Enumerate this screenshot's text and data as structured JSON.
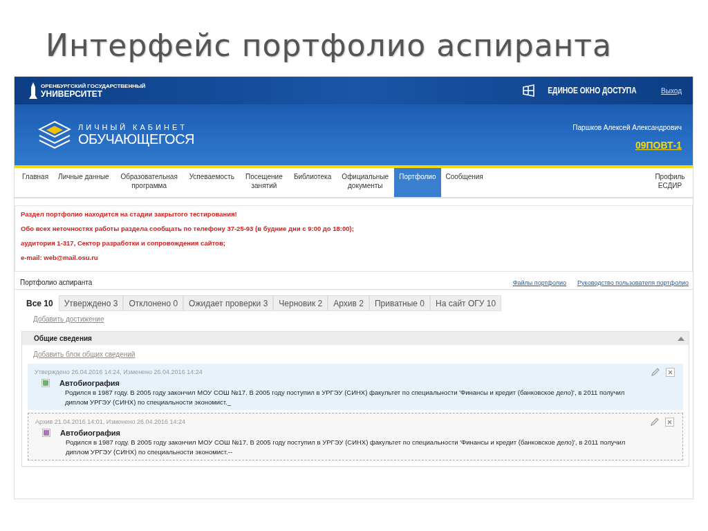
{
  "slide_title": "Интерфейс портфолио аспиранта",
  "header": {
    "university_small": "ОРЕНБУРГСКИЙ ГОСУДАРСТВЕННЫЙ",
    "university": "УНИВЕРСИТЕТ",
    "single_window": "ЕДИНОЕ ОКНО ДОСТУПА",
    "logout": "Выход",
    "cabinet_small": "ЛИЧНЫЙ КАБИНЕТ",
    "cabinet": "ОБУЧАЮЩЕГОСЯ",
    "user_name": "Паршков Алексей Александрович",
    "group": "09ПОВТ-1"
  },
  "nav": [
    {
      "label": "Главная",
      "selected": false
    },
    {
      "label": "Личные данные",
      "selected": false
    },
    {
      "label": "Образовательная программа",
      "selected": false
    },
    {
      "label": "Успеваемость",
      "selected": false
    },
    {
      "label": "Посещение занятий",
      "selected": false
    },
    {
      "label": "Библиотека",
      "selected": false
    },
    {
      "label": "Официальные документы",
      "selected": false
    },
    {
      "label": "Портфолио",
      "selected": true
    },
    {
      "label": "Сообщения",
      "selected": false
    }
  ],
  "nav_right": "Профиль ЕСДИР",
  "notice": [
    "Раздел портфолио находится на стадии закрытого тестирования!",
    "Обо всех неточностях работы раздела сообщать по телефону 37-25-93 (в будние дни с 9:00 до 18:00);",
    "аудитория 1-317, Сектор разработки и сопровождения сайтов;",
    "e-mail: web@mail.osu.ru"
  ],
  "portfolio_title": "Портфолио аспиранта",
  "links": [
    "Файлы портфолио",
    "Руководство пользователя портфолио"
  ],
  "tabs": [
    {
      "label": "Все 10",
      "selected": true
    },
    {
      "label": "Утверждено 3",
      "selected": false
    },
    {
      "label": "Отклонено 0",
      "selected": false
    },
    {
      "label": "Ожидает проверки 3",
      "selected": false
    },
    {
      "label": "Черновик 2",
      "selected": false
    },
    {
      "label": "Архив 2",
      "selected": false
    },
    {
      "label": "Приватные 0",
      "selected": false
    },
    {
      "label": "На сайт ОГУ 10",
      "selected": false
    }
  ],
  "add_achievement": "Добавить достижение",
  "section": {
    "title": "Общие сведения",
    "expanded": true,
    "add_link": "Добавить блок общих сведений"
  },
  "entries": [
    {
      "kind": "approved",
      "meta": "Утверждено 26.04.2016 14:24, Изменено 26.04.2016 14:24",
      "color": "#6cb36c",
      "title": "Автобиография",
      "text": "Родился в 1987 году. В 2005 году закончил МОУ СОШ №17. В 2005 году поступил в УРГЭУ (СИНХ) факультет по специальности 'Финансы и кредит (банковское дело)', в 2011 получил диплом УРГЭУ (СИНХ) по специальности экономист._"
    },
    {
      "kind": "archive",
      "meta": "Архив 21.04.2016 14:01, Изменено 26.04.2016 14:24",
      "color": "#a678b8",
      "title": "Автобиография",
      "text": "Родился в 1987 году. В 2005 году закончил МОУ СОШ №17. В 2005 году поступил в УРГЭУ (СИНХ) факультет по специальности 'Финансы и кредит (банковское дело)', в 2011 получил диплом УРГЭУ (СИНХ) по специальности экономист.--"
    }
  ]
}
